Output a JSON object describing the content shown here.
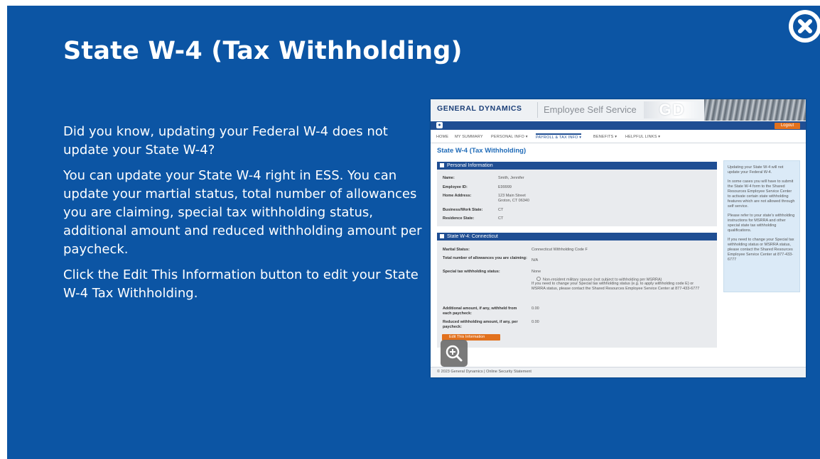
{
  "slide": {
    "title": "State W-4 (Tax Withholding)",
    "paragraphs": [
      "Did you know, updating your Federal W-4 does not update your State W-4?",
      "You can update your State W-4 right in ESS. You can update your martial status, total number of allowances you are claiming, special tax withholding status, additional amount and reduced withholding amount per paycheck.",
      "Click the Edit This Information button to edit your State W-4 Tax Withholding."
    ],
    "close_icon": "close-x-circle-icon",
    "zoom_icon": "zoom-in-icon"
  },
  "screenshot": {
    "brand": "GENERAL DYNAMICS",
    "app_title": "Employee Self Service",
    "logo": "GD",
    "logout": "Logout",
    "nav": [
      "HOME",
      "MY SUMMARY",
      "PERSONAL INFO ▾",
      "PAYROLL & TAX INFO ▾",
      "BENEFITS ▾",
      "HELPFUL LINKS ▾"
    ],
    "page_title": "State W-4 (Tax Withholding)",
    "personal": {
      "header": "Personal Information",
      "name_label": "Name:",
      "name_value": "Smith, Jennifer",
      "id_label": "Employee ID:",
      "id_value": "E99999",
      "address_label": "Home Address:",
      "address_line1": "123 Main Street",
      "address_line2": "Groton, CT 06340",
      "work_state_label": "Business/Work State:",
      "work_state_value": "CT",
      "res_state_label": "Residence State:",
      "res_state_value": "CT"
    },
    "w4": {
      "header": "State W-4: Connecticut",
      "marital_label": "Marital Status:",
      "marital_value": "Connecticut Withholding Code F",
      "allow_label": "Total number of allowances you are claiming:",
      "allow_value": "N/A",
      "special_label": "Special tax withholding status:",
      "special_value": "None",
      "special_option": "Non-resident military spouse (not subject to withholding per MSRRA)",
      "special_note": "If you need to change your Special tax withholding status (e.g. to apply withholding code E) or MSRRA status, please contact the Shared Resources Employee Service Center at 877-433-6777",
      "additional_label": "Additional amount, if any, withheld from each paycheck:",
      "additional_value": "0.00",
      "reduced_label": "Reduced withholding amount, if any, per paycheck:",
      "reduced_value": "0.00",
      "edit_button": "Edit This Information"
    },
    "sidebar": [
      "Updating your State W-4 will not update your Federal W-4.",
      "In some cases you will have to submit the State W-4 form to the Shared Resources Employee Service Center to activate certain state withholding features which are not allowed through self service.",
      "Please refer to your state's withholding instructions for MSRRA and other special state tax withholding qualifications.",
      "If you need to change your Special tax withholding status or MSRRA status, please contact the Shared Resources Employee Service Center at 877-433-6777"
    ],
    "footer": "© 2023 General Dynamics  |  Online Security Statement"
  }
}
